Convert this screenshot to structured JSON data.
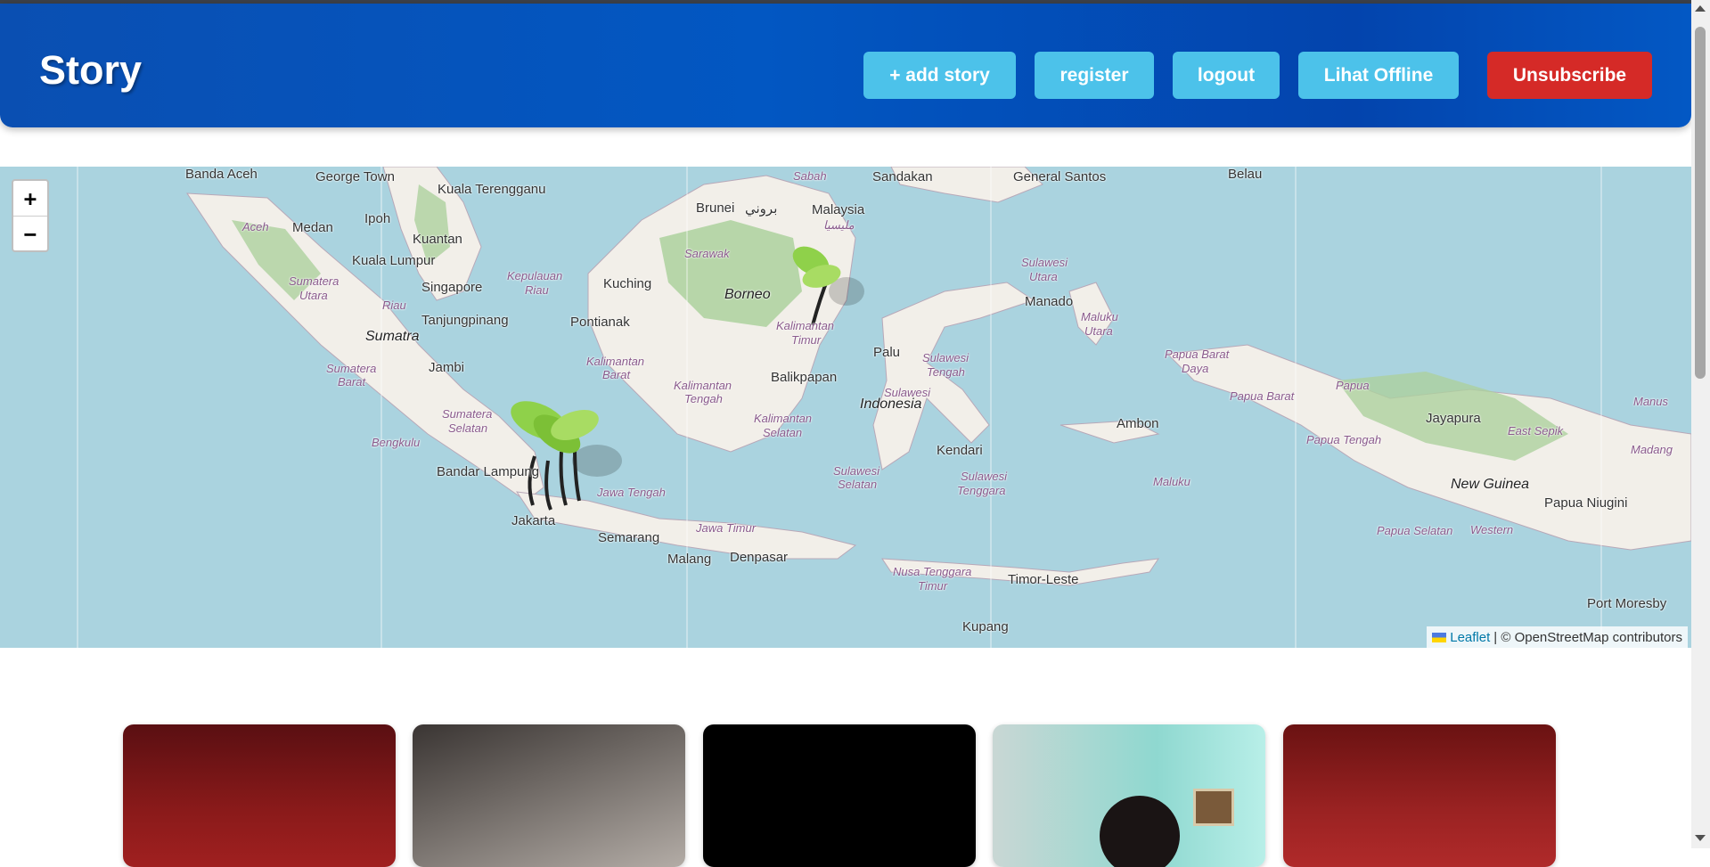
{
  "header": {
    "brand": "Story",
    "buttons": {
      "add_story": "+ add story",
      "register": "register",
      "logout": "logout",
      "offline": "Lihat Offline",
      "unsubscribe": "Unsubscribe"
    }
  },
  "map": {
    "zoom_in": "+",
    "zoom_out": "−",
    "attribution": {
      "link": "Leaflet",
      "text": "| © OpenStreetMap contributors"
    },
    "labels": {
      "banda_aceh": "Banda Aceh",
      "george_town": "George Town",
      "kuala_terengganu": "Kuala Terengganu",
      "medan": "Medan",
      "aceh": "Aceh",
      "ipoh": "Ipoh",
      "kuantan": "Kuantan",
      "kuala_lumpur": "Kuala Lumpur",
      "sumatera_utara_1": "Sumatera",
      "sumatera_utara_2": "Utara",
      "singapore": "Singapore",
      "riau": "Riau",
      "kepulauan_riau_1": "Kepulauan",
      "kepulauan_riau_2": "Riau",
      "tanjungpinang": "Tanjungpinang",
      "sumatra": "Sumatra",
      "sumatera_barat_1": "Sumatera",
      "sumatera_barat_2": "Barat",
      "jambi": "Jambi",
      "sumatera_selatan_1": "Sumatera",
      "sumatera_selatan_2": "Selatan",
      "bengkulu": "Bengkulu",
      "bandar_lampung": "Bandar Lampung",
      "jakarta": "Jakarta",
      "jawa_tengah": "Jawa Tengah",
      "semarang": "Semarang",
      "jawa_timur": "Jawa Timur",
      "malang": "Malang",
      "denpasar": "Denpasar",
      "kuching": "Kuching",
      "pontianak": "Pontianak",
      "sarawak": "Sarawak",
      "brunei": "Brunei",
      "brunei_local": "بروني",
      "sabah": "Sabah",
      "sandakan": "Sandakan",
      "malaysia": "Malaysia",
      "malaysia_local": "مليسيا",
      "borneo": "Borneo",
      "kalimantan_barat_1": "Kalimantan",
      "kalimantan_barat_2": "Barat",
      "kalimantan_tengah_1": "Kalimantan",
      "kalimantan_tengah_2": "Tengah",
      "kalimantan_timur_1": "Kalimantan",
      "kalimantan_timur_2": "Timur",
      "kalimantan_selatan_1": "Kalimantan",
      "kalimantan_selatan_2": "Selatan",
      "balikpapan": "Balikpapan",
      "palu": "Palu",
      "sulawesi": "Sulawesi",
      "indonesia": "Indonesia",
      "sulawesi_tengah_1": "Sulawesi",
      "sulawesi_tengah_2": "Tengah",
      "sulawesi_selatan_1": "Sulawesi",
      "sulawesi_selatan_2": "Selatan",
      "sulawesi_tenggara_1": "Sulawesi",
      "sulawesi_tenggara_2": "Tenggara",
      "kendari": "Kendari",
      "sulawesi_utara_1": "Sulawesi",
      "sulawesi_utara_2": "Utara",
      "manado": "Manado",
      "general_santos": "General Santos",
      "belau": "Belau",
      "maluku_utara_1": "Maluku",
      "maluku_utara_2": "Utara",
      "ambon": "Ambon",
      "maluku": "Maluku",
      "nusa_tenggara_timur_1": "Nusa Tenggara",
      "nusa_tenggara_timur_2": "Timur",
      "timor_leste": "Timor-Leste",
      "kupang": "Kupang",
      "papua_barat_daya_1": "Papua Barat",
      "papua_barat_daya_2": "Daya",
      "papua_barat": "Papua Barat",
      "papua": "Papua",
      "jayapura": "Jayapura",
      "papua_tengah": "Papua Tengah",
      "east_sepik": "East Sepik",
      "manus": "Manus",
      "madang": "Madang",
      "new_guinea": "New Guinea",
      "papua_niugini": "Papua Niugini",
      "papua_selatan": "Papua Selatan",
      "western": "Western",
      "port_moresby": "Port Moresby"
    }
  },
  "cards": [
    {
      "name": "story-card-1"
    },
    {
      "name": "story-card-2"
    },
    {
      "name": "story-card-3"
    },
    {
      "name": "story-card-4"
    },
    {
      "name": "story-card-5"
    }
  ],
  "colors": {
    "header": "#0257c2",
    "nav_button": "#4cc2ea",
    "danger_button": "#d52a27",
    "sea": "#aad3df",
    "land": "#f2efe9",
    "forest": "#add19e"
  }
}
